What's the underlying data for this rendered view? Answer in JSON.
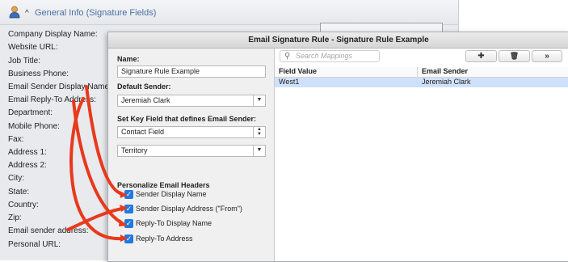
{
  "section": {
    "title": "General Info (Signature Fields)",
    "fields": [
      "Company Display Name:",
      "Website URL:",
      "Job Title:",
      "Business Phone:",
      "Email Sender Display Name:",
      "Email Reply-To Address:",
      "Department:",
      "Mobile Phone:",
      "Fax:",
      "Address 1:",
      "Address 2:",
      "City:",
      "State:",
      "Country:",
      "Zip:",
      "Email sender address:",
      "Personal URL:"
    ]
  },
  "dialog": {
    "title": "Email Signature Rule - Signature Rule Example",
    "name_label": "Name:",
    "name_value": "Signature Rule Example",
    "default_sender_label": "Default Sender:",
    "default_sender_value": "Jeremiah Clark",
    "key_field_label": "Set Key Field that defines Email Sender:",
    "key_field_type_value": "Contact Field",
    "key_field_value": "Territory",
    "headers_label": "Personalize Email Headers",
    "checkboxes": [
      {
        "label": "Sender Display Name",
        "checked": true
      },
      {
        "label": "Sender Display Address (\"From\")",
        "checked": true
      },
      {
        "label": "Reply-To Display Name",
        "checked": true
      },
      {
        "label": "Reply-To Address",
        "checked": true
      }
    ],
    "search_placeholder": "Search Mappings",
    "add_glyph": "✚",
    "delete_glyph": "🗑",
    "more_glyph": "»",
    "columns": [
      "Field Value",
      "Email Sender"
    ],
    "rows": [
      {
        "field_value": "West1",
        "email_sender": "Jeremiah Clark"
      }
    ]
  },
  "colors": {
    "accent": "#1f7ae0",
    "annotation_arrow": "#e8391c",
    "selected_row": "#cfe1fa"
  }
}
